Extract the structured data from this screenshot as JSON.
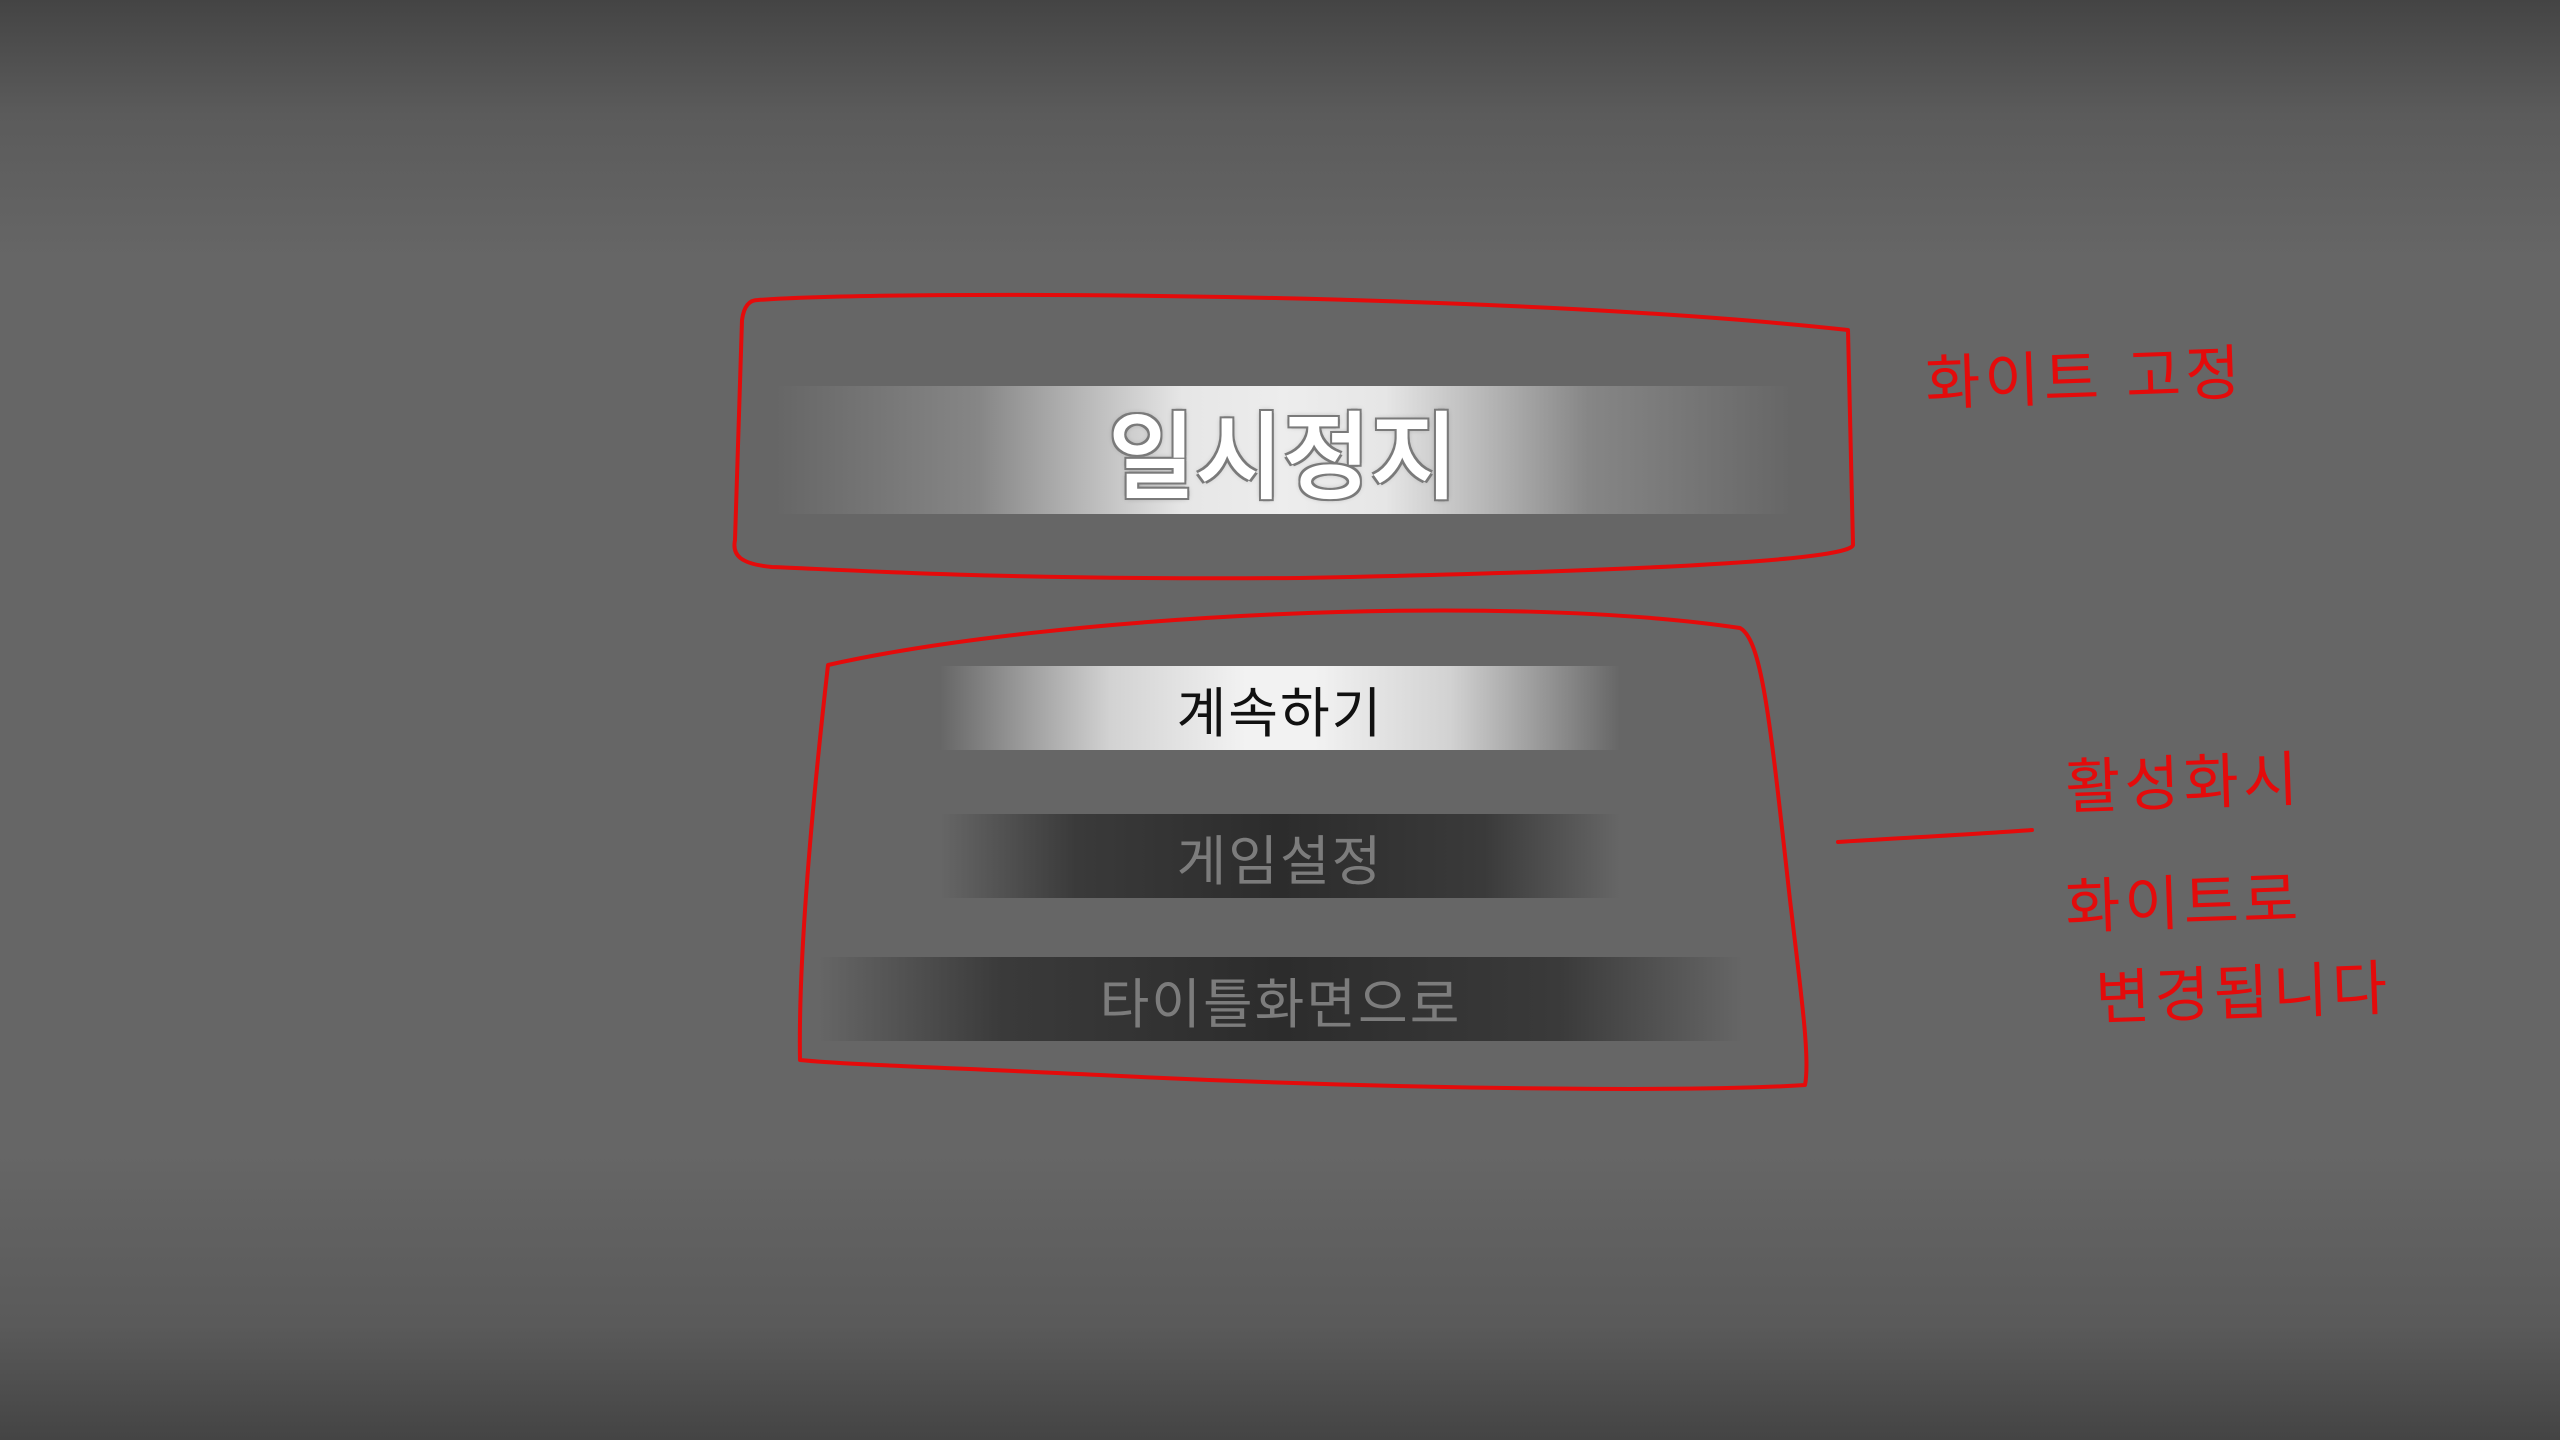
{
  "pause_menu": {
    "title": "일시정지",
    "items": [
      {
        "label": "계속하기",
        "state": "selected"
      },
      {
        "label": "게임설정",
        "state": "normal"
      },
      {
        "label": "타이틀화면으로",
        "state": "normal"
      }
    ]
  },
  "annotations": {
    "title_note": "화이트 고정",
    "menu_note_line1": "활성화시",
    "menu_note_line2": "화이트로",
    "menu_note_line3": "변경됩니다"
  },
  "colors": {
    "annotation": "#e40b0b",
    "background": "#666666",
    "selected_text": "#111111",
    "unselected_text": "#7c7c7c"
  }
}
